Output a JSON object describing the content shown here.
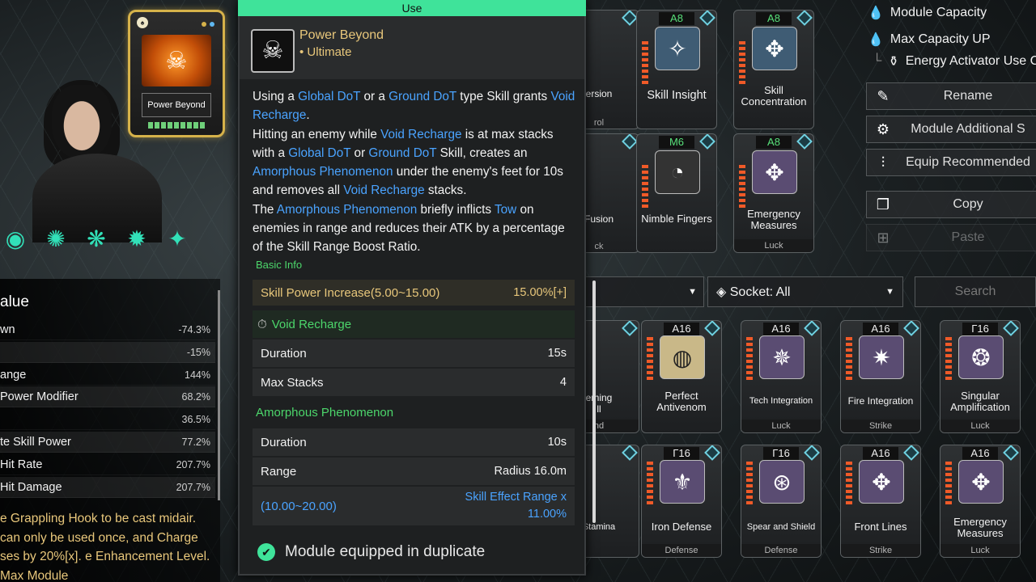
{
  "equipped": {
    "name": "Power Beyond"
  },
  "skill_icons": [
    "◉",
    "✺",
    "❋",
    "✹",
    "✦"
  ],
  "stats_panel": {
    "title": "alue",
    "rows": [
      {
        "label": "wn",
        "value": "-74.3%"
      },
      {
        "label": "",
        "value": "-15%"
      },
      {
        "label": "ange",
        "value": "144%"
      },
      {
        "label": "Power Modifier",
        "value": "68.2%"
      },
      {
        "label": "",
        "value": "36.5%"
      },
      {
        "label": "te Skill Power",
        "value": "77.2%"
      },
      {
        "label": "Hit Rate",
        "value": "207.7%"
      },
      {
        "label": "Hit Damage",
        "value": "207.7%"
      }
    ],
    "description": "e Grappling Hook to be cast midair. can only be used once, and Charge ses by 20%[x]. e Enhancement Level. Max Module"
  },
  "tooltip": {
    "use_label": "Use",
    "name": "Power Beyond",
    "type": "• Ultimate",
    "desc": {
      "t1": "Using a ",
      "k1": "Global DoT",
      "t2": " or a ",
      "k2": "Ground DoT",
      "t3": " type Skill grants ",
      "k3": "Void Recharge",
      "t4": ".",
      "t5": "Hitting an enemy while ",
      "k4": "Void Recharge",
      "t6": " is at max stacks with a ",
      "k5": "Global DoT",
      "t7": " or ",
      "k6": "Ground DoT",
      "t8": " Skill, creates an ",
      "k7": "Amorphous Phenomenon",
      "t9": " under the enemy's feet for 10s and removes all ",
      "k8": "Void Recharge",
      "t10": " stacks.",
      "t11": "The ",
      "k9": "Amorphous Phenomenon",
      "t12": " briefly inflicts ",
      "k10": "Tow",
      "t13": " on enemies in range and reduces their ATK by a percentage of the Skill Range Boost Ratio."
    },
    "basic_info": "Basic Info",
    "skill_power": {
      "label": "Skill Power Increase(5.00~15.00)",
      "value": "15.00%[+]"
    },
    "void_recharge_title": "Void Recharge",
    "vr_duration": {
      "label": "Duration",
      "value": "15s"
    },
    "vr_max_stacks": {
      "label": "Max Stacks",
      "value": "4"
    },
    "amorphous_title": "Amorphous Phenomenon",
    "ap_duration": {
      "label": "Duration",
      "value": "10s"
    },
    "ap_range": {
      "label": "Range",
      "value": "Radius 16.0m"
    },
    "ap_reduction": {
      "label": "(10.00~20.00)",
      "value_line1": "Skill Effect Range x",
      "value_line2": "11.00%"
    },
    "duplicate": "Module equipped in duplicate"
  },
  "top_cards": [
    {
      "name": "ersion",
      "sub": "rol",
      "badge": ""
    },
    {
      "name": "Skill Insight",
      "sub": "",
      "badge": "A8"
    },
    {
      "name": "Skill Concentration",
      "sub": "",
      "badge": "A8"
    },
    {
      "name": "Fusion",
      "sub": "ck",
      "badge": ""
    },
    {
      "name": "Nimble Fingers",
      "sub": "",
      "badge": "M6"
    },
    {
      "name": "Emergency Measures",
      "sub": "Luck",
      "badge": "A8"
    }
  ],
  "list_cards_row1": [
    {
      "name": "eming",
      "name2": "ll",
      "socket": "nd",
      "badge": ""
    },
    {
      "name": "Perfect Antivenom",
      "socket": "",
      "badge": "A16"
    },
    {
      "name": "Tech Integration",
      "socket": "Luck",
      "badge": "A16"
    },
    {
      "name": "Fire Integration",
      "socket": "Strike",
      "badge": "A16"
    },
    {
      "name": "Singular Amplification",
      "socket": "Luck",
      "badge": "Γ16"
    }
  ],
  "list_cards_row2": [
    {
      "name": "Stamina",
      "socket": "",
      "badge": ""
    },
    {
      "name": "Iron Defense",
      "socket": "Defense",
      "badge": "Γ16"
    },
    {
      "name": "Spear and Shield",
      "socket": "Defense",
      "badge": "Γ16"
    },
    {
      "name": "Front Lines",
      "socket": "Strike",
      "badge": "A16"
    },
    {
      "name": "Emergency Measures",
      "socket": "Luck",
      "badge": "A16"
    }
  ],
  "right_panel": {
    "module_capacity": "Module Capacity",
    "max_capacity_up": "Max Capacity UP",
    "energy_activator": "Energy Activator Use Co",
    "buttons": [
      "Rename",
      "Module Additional S",
      "Equip Recommended",
      "Copy",
      "Paste"
    ]
  },
  "filters": {
    "socket": "Socket: All",
    "search_placeholder": "Search"
  }
}
